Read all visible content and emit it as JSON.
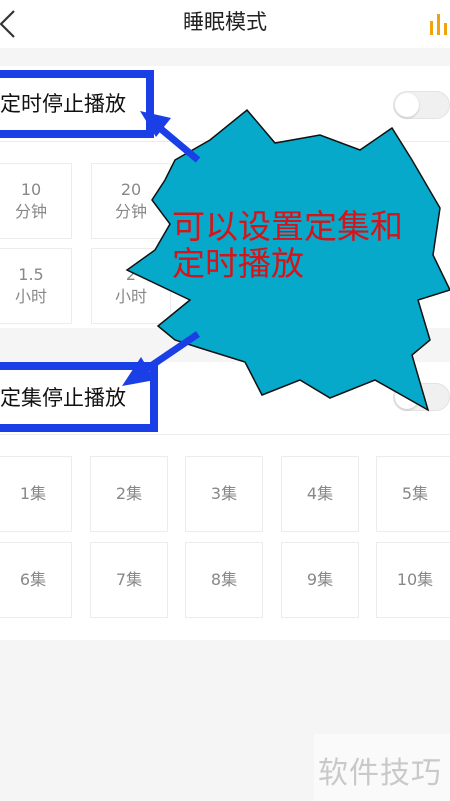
{
  "header": {
    "title": "睡眠模式",
    "back_icon": "back-chevron-icon",
    "playing_icon": "equalizer-bars-icon",
    "accent": "#f0a30a"
  },
  "timer_section": {
    "title": "定时停止播放",
    "toggle_on": false,
    "options": [
      {
        "value": "10",
        "unit": "分钟"
      },
      {
        "value": "20",
        "unit": "分钟"
      },
      {
        "value": "1.5",
        "unit": "小时"
      },
      {
        "value": "2",
        "unit": "小时"
      }
    ]
  },
  "episode_section": {
    "title": "定集停止播放",
    "toggle_on": false,
    "options": [
      "1集",
      "2集",
      "3集",
      "4集",
      "5集",
      "6集",
      "7集",
      "8集",
      "9集",
      "10集"
    ]
  },
  "annotation": {
    "text": "可以设置定集和定时播放",
    "callout_color": "#06a9c9",
    "text_color": "#d4141a",
    "box_color": "#1a3fe6"
  },
  "watermark": "软件技巧"
}
